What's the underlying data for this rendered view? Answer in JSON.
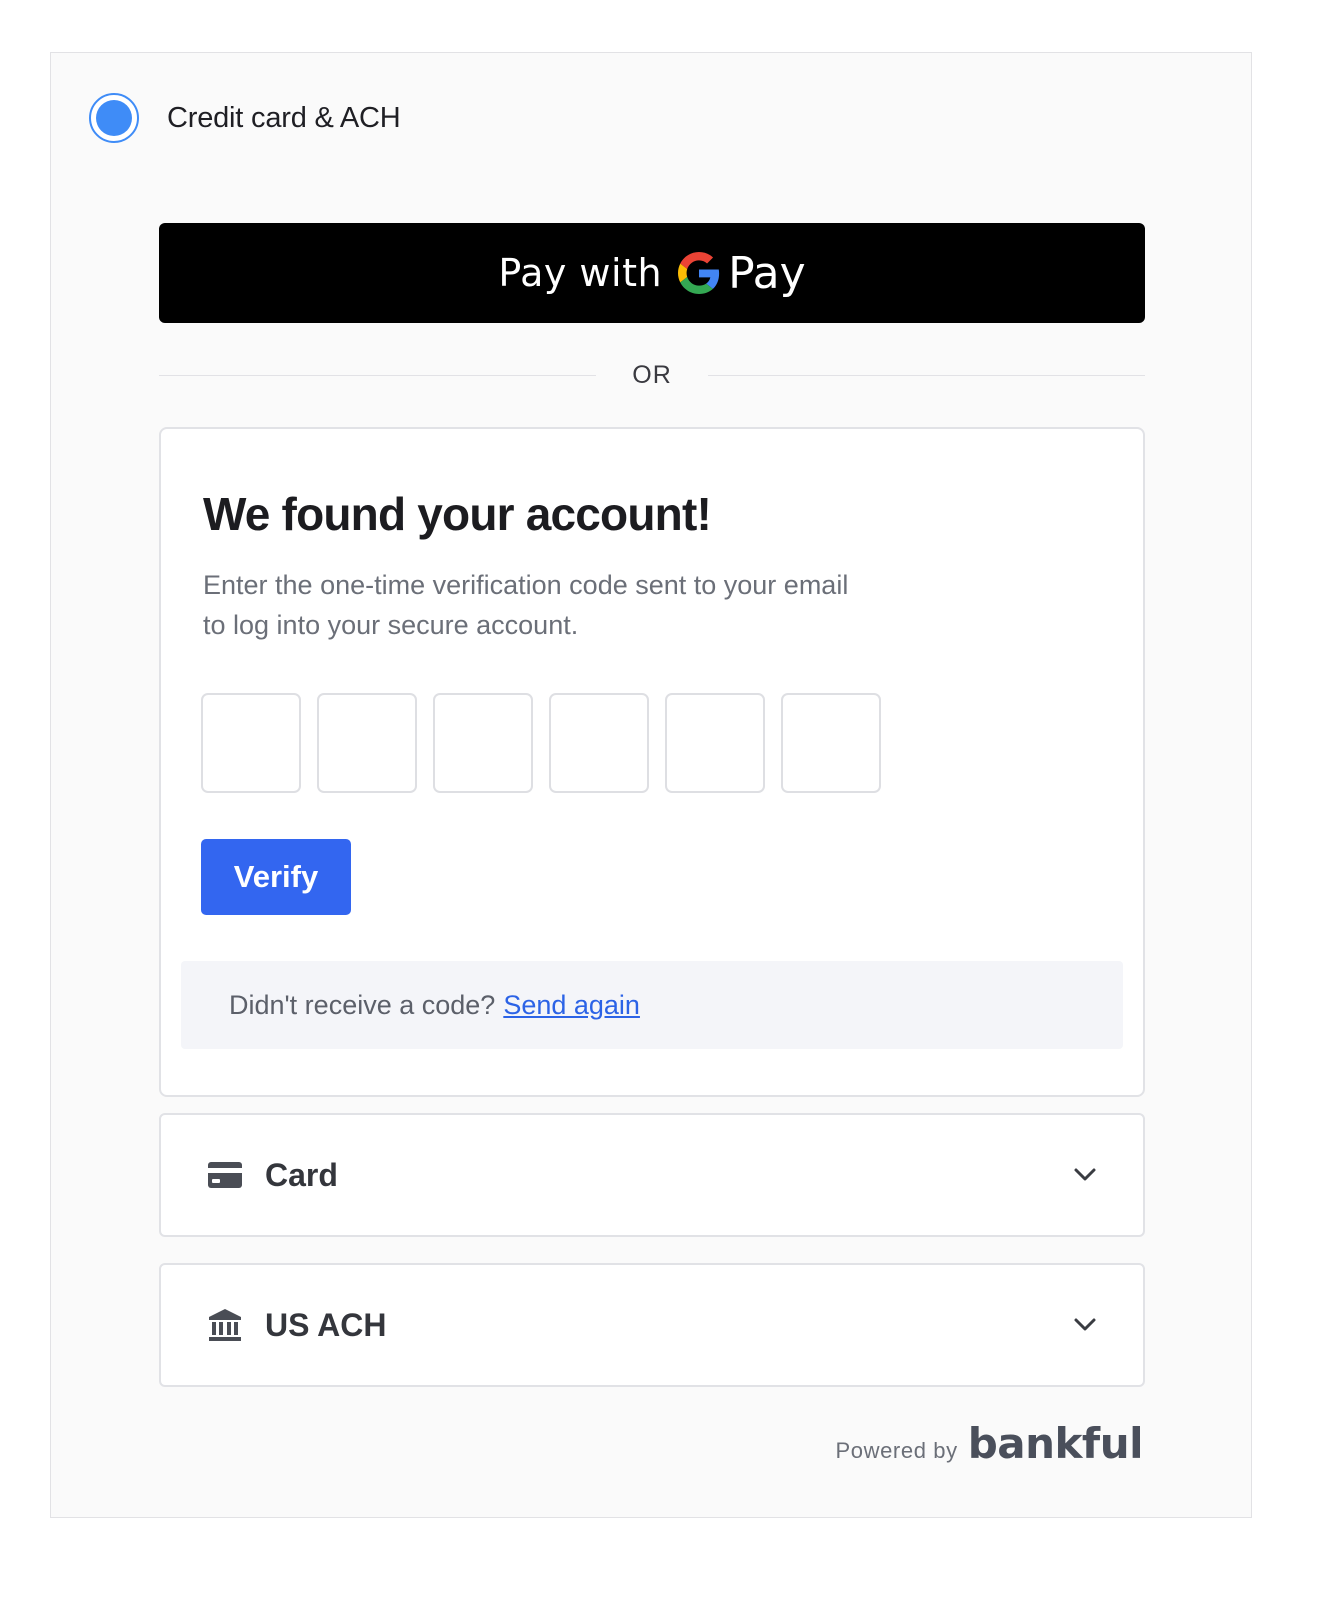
{
  "payment_method": {
    "label": "Credit card & ACH",
    "selected": true
  },
  "gpay_button": {
    "prefix": "Pay with",
    "suffix": "Pay",
    "icon": "google-g-icon"
  },
  "divider": {
    "text": "OR"
  },
  "verification": {
    "title": "We found your account!",
    "description": "Enter the one-time verification code sent to your email to log into your secure account.",
    "code_digits": [
      "",
      "",
      "",
      "",
      "",
      ""
    ],
    "verify_label": "Verify",
    "resend_prompt": "Didn't receive a code?",
    "resend_link": "Send again"
  },
  "accordions": [
    {
      "label": "Card",
      "icon": "credit-card-icon",
      "expanded": false
    },
    {
      "label": "US ACH",
      "icon": "bank-icon",
      "expanded": false
    }
  ],
  "footer": {
    "powered_by": "Powered by",
    "brand": "bankful"
  },
  "colors": {
    "accent": "#3366f0",
    "radio": "#3f8cf7",
    "link": "#2c63e6"
  }
}
